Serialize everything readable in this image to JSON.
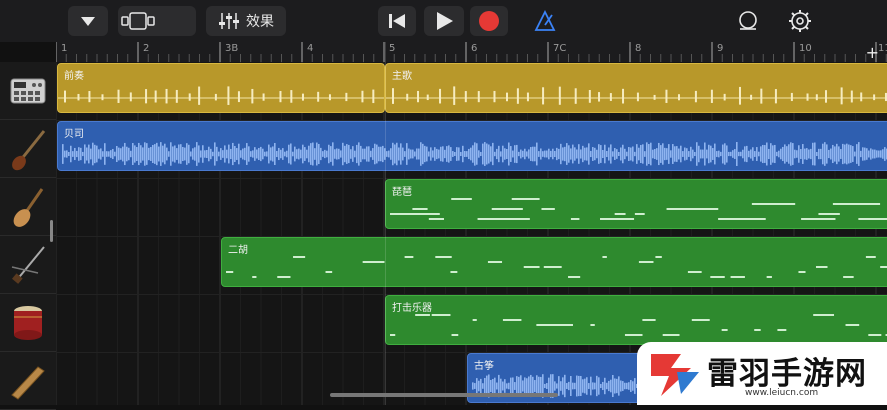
{
  "toolbar": {
    "fx_label": "效果",
    "icons": [
      "browser-dropdown-icon",
      "tracks-view-icon",
      "mixer-icon",
      "go-to-start-icon",
      "play-icon",
      "record-icon",
      "metronome-icon",
      "loop-icon",
      "settings-icon"
    ],
    "accent_record": "#e53935",
    "accent_metronome": "#3b82f6"
  },
  "ruler": {
    "labels": [
      "1",
      "2",
      "3B",
      "4",
      "5",
      "6",
      "7C",
      "8",
      "9",
      "10",
      "11"
    ],
    "add_label": "+"
  },
  "tracks": [
    {
      "instrument": "drum-machine-icon",
      "regions": [
        {
          "name": "前奏",
          "color": "gold"
        },
        {
          "name": "主歌",
          "color": "gold"
        }
      ]
    },
    {
      "instrument": "bass-guitar-icon",
      "regions": [
        {
          "name": "贝司",
          "color": "blue"
        }
      ]
    },
    {
      "instrument": "pipa-icon",
      "regions": [
        {
          "name": "琵琶",
          "color": "green"
        }
      ]
    },
    {
      "instrument": "erhu-icon",
      "regions": [
        {
          "name": "二胡",
          "color": "green"
        }
      ]
    },
    {
      "instrument": "drum-icon",
      "regions": [
        {
          "name": "打击乐器",
          "color": "green"
        }
      ]
    },
    {
      "instrument": "guzheng-icon",
      "regions": [
        {
          "name": "古筝",
          "color": "blue"
        }
      ]
    }
  ],
  "watermark": {
    "title": "雷羽手游网",
    "url": "www.leiucn.com"
  }
}
